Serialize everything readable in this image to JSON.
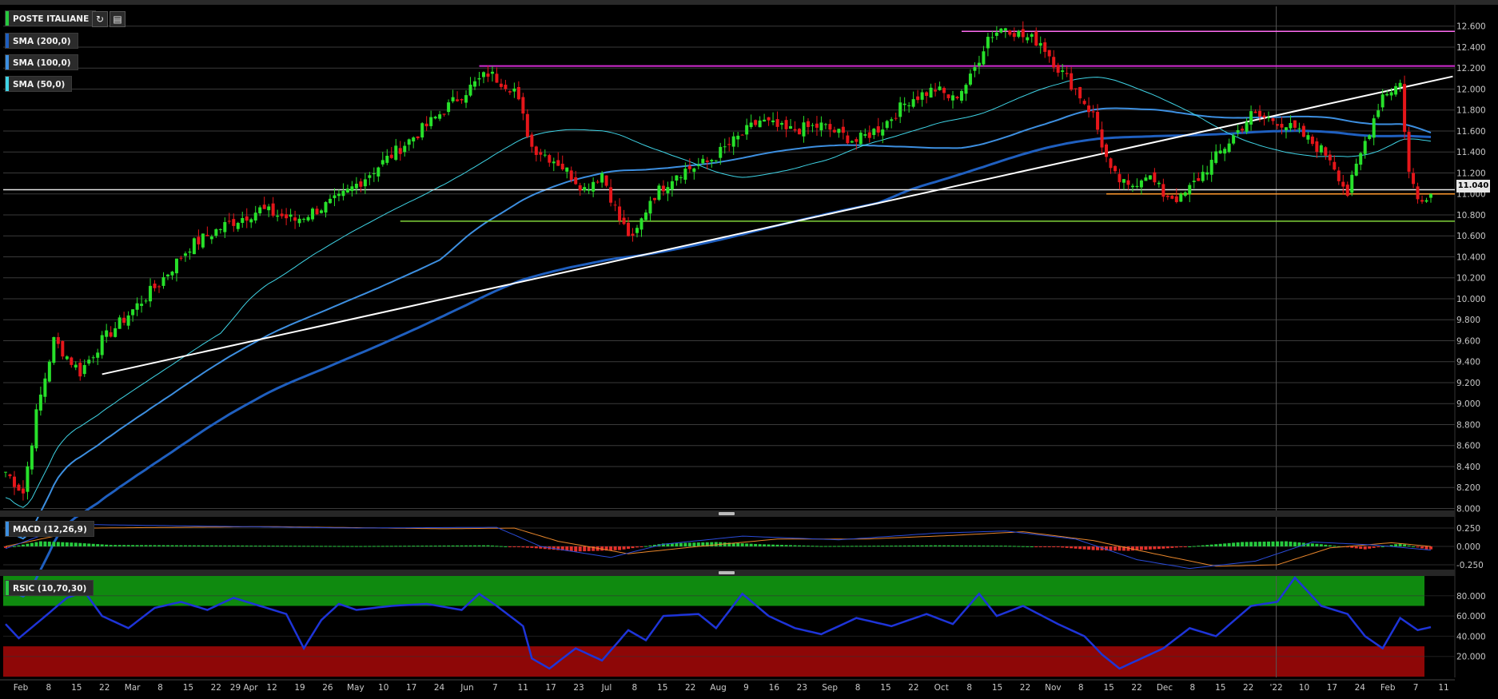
{
  "panels": {
    "price": {
      "legend": [
        {
          "label": "POSTE ITALIANE",
          "color": "#27c93f"
        },
        {
          "label": "SMA (200,0)",
          "color": "#1f5fbf"
        },
        {
          "label": "SMA (100,0)",
          "color": "#3d8fe0"
        },
        {
          "label": "SMA (50,0)",
          "color": "#3fd4e6"
        }
      ],
      "last_price_label": "11.040",
      "tools": {
        "refresh": "refresh-icon",
        "settings": "chart-settings-icon"
      }
    },
    "macd": {
      "label": "MACD (12,26,9)",
      "color": "#3d8fe0"
    },
    "rsi": {
      "label": "RSIC (10,70,30)",
      "color": "#27c93f"
    }
  },
  "chart_data": [
    {
      "type": "candlestick",
      "series_name": "POSTE ITALIANE",
      "y_ticks": [
        "12.600",
        "12.400",
        "12.200",
        "12.000",
        "11.800",
        "11.600",
        "11.400",
        "11.200",
        "11.000",
        "10.800",
        "10.600",
        "10.400",
        "10.200",
        "10.000",
        "9.800",
        "9.600",
        "9.400",
        "9.200",
        "9.000",
        "8.800",
        "8.600",
        "8.400",
        "8.200",
        "8.000"
      ],
      "ylim": [
        7.95,
        12.75
      ],
      "x_ticks": [
        "Feb",
        "8",
        "15",
        "22",
        "Mar",
        "8",
        "15",
        "22",
        "29 Apr",
        "12",
        "19",
        "26",
        "May",
        "10",
        "17",
        "24",
        "Jun",
        "7",
        "11",
        "17",
        "23",
        "Jul",
        "8",
        "15",
        "22",
        "Aug",
        "9",
        "16",
        "23",
        "Sep",
        "8",
        "15",
        "22",
        "Oct",
        "8",
        "15",
        "22",
        "Nov",
        "8",
        "15",
        "22",
        "Dec",
        "8",
        "15",
        "22",
        "'22",
        "10",
        "17",
        "24",
        "Feb",
        "7",
        "11"
      ],
      "close_path": [
        [
          0,
          8.35
        ],
        [
          4,
          8.15
        ],
        [
          7,
          8.9
        ],
        [
          11,
          9.6
        ],
        [
          17,
          9.3
        ],
        [
          22,
          9.6
        ],
        [
          28,
          9.85
        ],
        [
          35,
          10.15
        ],
        [
          42,
          10.5
        ],
        [
          50,
          10.7
        ],
        [
          58,
          10.85
        ],
        [
          66,
          10.75
        ],
        [
          76,
          10.95
        ],
        [
          86,
          11.3
        ],
        [
          96,
          11.65
        ],
        [
          104,
          11.95
        ],
        [
          110,
          12.15
        ],
        [
          116,
          12.0
        ],
        [
          120,
          11.45
        ],
        [
          126,
          11.3
        ],
        [
          132,
          11.05
        ],
        [
          136,
          11.2
        ],
        [
          140,
          10.75
        ],
        [
          143,
          10.55
        ],
        [
          147,
          10.95
        ],
        [
          153,
          11.2
        ],
        [
          160,
          11.3
        ],
        [
          166,
          11.5
        ],
        [
          172,
          11.7
        ],
        [
          178,
          11.6
        ],
        [
          186,
          11.65
        ],
        [
          194,
          11.5
        ],
        [
          200,
          11.65
        ],
        [
          206,
          11.9
        ],
        [
          212,
          12.0
        ],
        [
          216,
          11.9
        ],
        [
          220,
          12.1
        ],
        [
          224,
          12.5
        ],
        [
          228,
          12.6
        ],
        [
          232,
          12.5
        ],
        [
          236,
          12.45
        ],
        [
          240,
          12.2
        ],
        [
          244,
          12.0
        ],
        [
          248,
          11.75
        ],
        [
          252,
          11.2
        ],
        [
          256,
          11.05
        ],
        [
          260,
          11.2
        ],
        [
          264,
          11.0
        ],
        [
          268,
          10.95
        ],
        [
          272,
          11.15
        ],
        [
          278,
          11.45
        ],
        [
          284,
          11.75
        ],
        [
          290,
          11.7
        ],
        [
          296,
          11.55
        ],
        [
          302,
          11.35
        ],
        [
          306,
          11.0
        ],
        [
          310,
          11.5
        ],
        [
          314,
          11.95
        ],
        [
          318,
          12.05
        ],
        [
          320,
          11.2
        ],
        [
          322,
          10.95
        ],
        [
          324,
          11.0
        ]
      ],
      "horizontal_lines": [
        {
          "value": 12.55,
          "color": "#ff6df2"
        },
        {
          "value": 12.22,
          "color": "#d12bd1"
        },
        {
          "value": 11.04,
          "color": "#e6e6e6"
        },
        {
          "value": 11.0,
          "color": "#ff9a2e"
        },
        {
          "value": 10.74,
          "color": "#7fd23a"
        }
      ],
      "trendline": {
        "from": [
          22,
          9.28
        ],
        "to": [
          330,
          12.12
        ],
        "color": "#ffffff"
      },
      "sma_color_200": "#1f5fbf",
      "sma_color_100": "#3d8fe0",
      "sma_color_50": "#3fd4e6"
    },
    {
      "type": "histogram",
      "series_name": "MACD",
      "y_ticks": [
        "0.250",
        "0.000",
        "-0.250"
      ],
      "ylim": [
        -0.3,
        0.3
      ],
      "histogram_path": [
        [
          0,
          -0.02
        ],
        [
          8,
          0.07
        ],
        [
          16,
          0.05
        ],
        [
          24,
          0.02
        ],
        [
          40,
          0.015
        ],
        [
          60,
          0.01
        ],
        [
          80,
          0.005
        ],
        [
          95,
          0.01
        ],
        [
          110,
          0.015
        ],
        [
          120,
          -0.02
        ],
        [
          130,
          -0.07
        ],
        [
          140,
          -0.05
        ],
        [
          150,
          0.04
        ],
        [
          162,
          0.06
        ],
        [
          172,
          0.03
        ],
        [
          186,
          0.005
        ],
        [
          200,
          0.01
        ],
        [
          212,
          0.015
        ],
        [
          228,
          0.01
        ],
        [
          240,
          -0.01
        ],
        [
          248,
          -0.05
        ],
        [
          256,
          -0.06
        ],
        [
          264,
          -0.03
        ],
        [
          272,
          0.01
        ],
        [
          282,
          0.06
        ],
        [
          292,
          0.07
        ],
        [
          300,
          0.03
        ],
        [
          310,
          -0.04
        ],
        [
          318,
          0.04
        ],
        [
          324,
          -0.04
        ]
      ],
      "macd_path": [
        [
          0,
          -0.03
        ],
        [
          15,
          0.3
        ],
        [
          40,
          0.28
        ],
        [
          80,
          0.25
        ],
        [
          112,
          0.26
        ],
        [
          122,
          0.0
        ],
        [
          138,
          -0.15
        ],
        [
          150,
          0.03
        ],
        [
          168,
          0.14
        ],
        [
          190,
          0.09
        ],
        [
          212,
          0.18
        ],
        [
          228,
          0.21
        ],
        [
          244,
          0.1
        ],
        [
          258,
          -0.18
        ],
        [
          270,
          -0.3
        ],
        [
          285,
          -0.2
        ],
        [
          298,
          0.06
        ],
        [
          312,
          0.02
        ],
        [
          325,
          -0.05
        ]
      ],
      "signal_path": [
        [
          0,
          0.0
        ],
        [
          20,
          0.25
        ],
        [
          60,
          0.27
        ],
        [
          100,
          0.24
        ],
        [
          116,
          0.25
        ],
        [
          126,
          0.07
        ],
        [
          142,
          -0.1
        ],
        [
          158,
          0.0
        ],
        [
          176,
          0.1
        ],
        [
          196,
          0.1
        ],
        [
          216,
          0.15
        ],
        [
          232,
          0.2
        ],
        [
          248,
          0.08
        ],
        [
          262,
          -0.1
        ],
        [
          276,
          -0.27
        ],
        [
          290,
          -0.25
        ],
        [
          302,
          -0.02
        ],
        [
          316,
          0.05
        ],
        [
          325,
          0.0
        ]
      ],
      "colors": {
        "positive": "#27c93f",
        "negative": "#e2312b",
        "macd": "#2a4bd8",
        "signal": "#e8862b"
      }
    },
    {
      "type": "line",
      "series_name": "RSIC",
      "y_ticks": [
        "80.000",
        "60.000",
        "40.000",
        "20.000"
      ],
      "ylim": [
        0,
        100
      ],
      "overbought": 70,
      "oversold": 30,
      "rsi_path": [
        [
          0,
          52
        ],
        [
          3,
          38
        ],
        [
          8,
          56
        ],
        [
          14,
          78
        ],
        [
          18,
          84
        ],
        [
          22,
          60
        ],
        [
          28,
          48
        ],
        [
          34,
          68
        ],
        [
          40,
          74
        ],
        [
          46,
          66
        ],
        [
          52,
          78
        ],
        [
          58,
          70
        ],
        [
          64,
          62
        ],
        [
          68,
          28
        ],
        [
          72,
          56
        ],
        [
          76,
          72
        ],
        [
          80,
          66
        ],
        [
          88,
          70
        ],
        [
          96,
          72
        ],
        [
          104,
          66
        ],
        [
          108,
          82
        ],
        [
          112,
          70
        ],
        [
          118,
          50
        ],
        [
          120,
          18
        ],
        [
          124,
          8
        ],
        [
          130,
          28
        ],
        [
          136,
          16
        ],
        [
          142,
          46
        ],
        [
          146,
          36
        ],
        [
          150,
          60
        ],
        [
          158,
          62
        ],
        [
          162,
          48
        ],
        [
          168,
          82
        ],
        [
          174,
          60
        ],
        [
          180,
          48
        ],
        [
          186,
          42
        ],
        [
          194,
          58
        ],
        [
          202,
          50
        ],
        [
          210,
          62
        ],
        [
          216,
          52
        ],
        [
          222,
          82
        ],
        [
          226,
          60
        ],
        [
          232,
          70
        ],
        [
          240,
          52
        ],
        [
          246,
          40
        ],
        [
          250,
          22
        ],
        [
          254,
          8
        ],
        [
          258,
          16
        ],
        [
          264,
          28
        ],
        [
          270,
          48
        ],
        [
          276,
          40
        ],
        [
          284,
          70
        ],
        [
          290,
          74
        ],
        [
          294,
          98
        ],
        [
          300,
          70
        ],
        [
          306,
          62
        ],
        [
          310,
          40
        ],
        [
          314,
          28
        ],
        [
          318,
          58
        ],
        [
          322,
          46
        ],
        [
          326,
          50
        ]
      ],
      "colors": {
        "line": "#1e34d8",
        "overbought_zone": "#0f8a0f",
        "oversold_zone": "#8e0707"
      }
    }
  ]
}
